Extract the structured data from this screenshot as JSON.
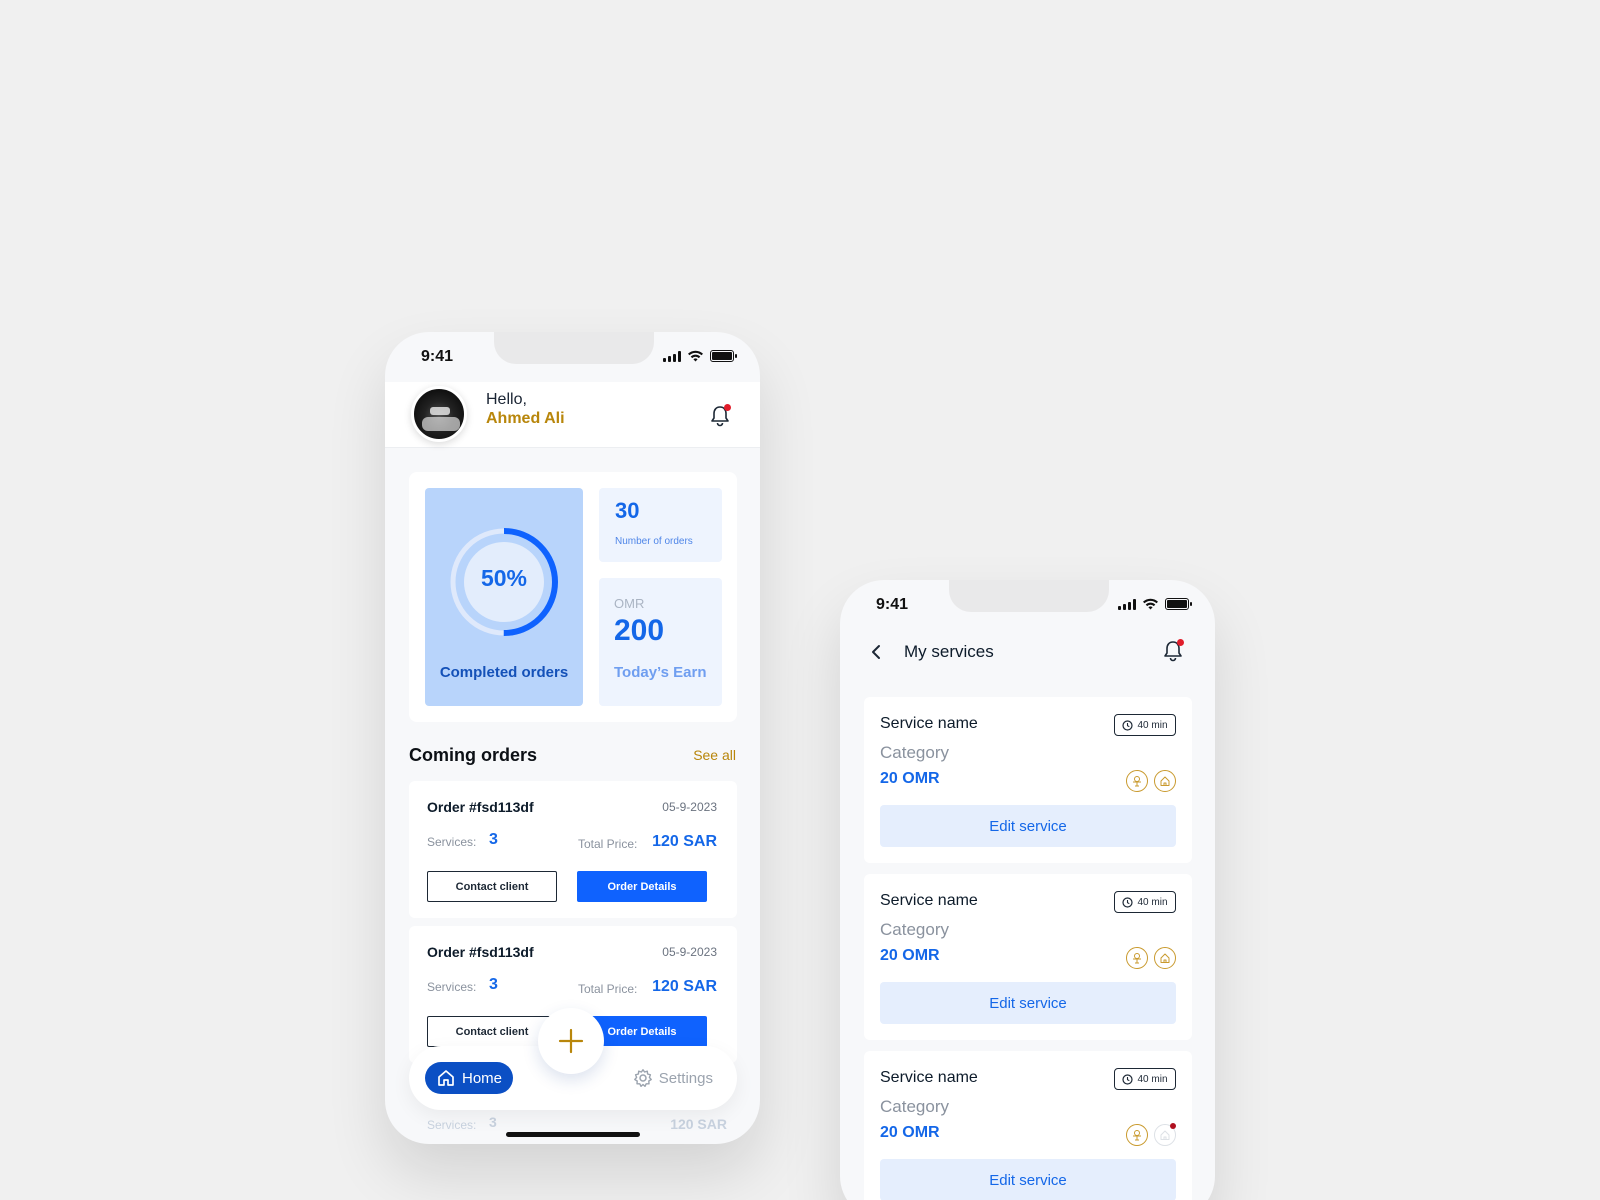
{
  "phone1": {
    "status_time": "9:41",
    "greeting": "Hello,",
    "user_name": "Ahmed Ali",
    "stats": {
      "completed_percent_label": "50%",
      "completed_fraction": 0.5,
      "completed_label": "Completed orders",
      "orders_count": "30",
      "orders_label": "Number of orders",
      "earn_currency": "OMR",
      "earn_amount": "200",
      "earn_label": "Today’s Earn"
    },
    "section_title": "Coming orders",
    "see_all": "See all",
    "orders": [
      {
        "id": "Order #fsd113df",
        "date": "05-9-2023",
        "services_label": "Services:",
        "services_count": "3",
        "total_label": "Total Price:",
        "total_value": "120 SAR",
        "contact_label": "Contact client",
        "details_label": "Order Details"
      },
      {
        "id": "Order #fsd113df",
        "date": "05-9-2023",
        "services_label": "Services:",
        "services_count": "3",
        "total_label": "Total Price:",
        "total_value": "120 SAR",
        "contact_label": "Contact client",
        "details_label": "Order Details"
      }
    ],
    "peek": {
      "services_label": "Services:",
      "services_count": "3",
      "total_value": "120 SAR"
    },
    "nav": {
      "home": "Home",
      "settings": "Settings"
    }
  },
  "phone2": {
    "status_time": "9:41",
    "title": "My services",
    "services": [
      {
        "name": "Service name",
        "category": "Category",
        "price": "20 OMR",
        "duration": "40 min",
        "edit_label": "Edit service"
      },
      {
        "name": "Service name",
        "category": "Category",
        "price": "20 OMR",
        "duration": "40 min",
        "edit_label": "Edit service"
      },
      {
        "name": "Service name",
        "category": "Category",
        "price": "20 OMR",
        "duration": "40 min",
        "edit_label": "Edit service"
      }
    ]
  },
  "colors": {
    "primary": "#0f62fe",
    "accent_gold": "#b8860b",
    "notification": "#e11d2a"
  }
}
